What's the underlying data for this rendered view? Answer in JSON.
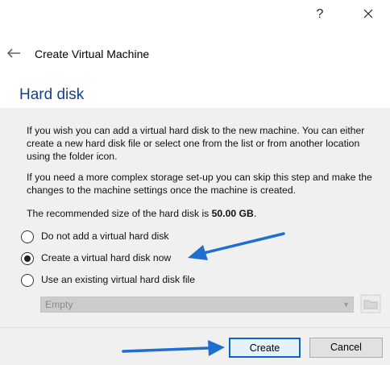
{
  "titlebar": {
    "help_label": "?"
  },
  "header": {
    "back_icon": "back-arrow-icon",
    "title": "Create Virtual Machine"
  },
  "page": {
    "title": "Hard disk",
    "para1": "If you wish you can add a virtual hard disk to the new machine. You can either create a new hard disk file or select one from the list or from another location using the folder icon.",
    "para2": "If you need a more complex storage set-up you can skip this step and make the changes to the machine settings once the machine is created.",
    "para3_prefix": "The recommended size of the hard disk is ",
    "para3_size": "50.00 GB",
    "para3_suffix": "."
  },
  "options": [
    {
      "label": "Do not add a virtual hard disk",
      "selected": false
    },
    {
      "label": "Create a virtual hard disk now",
      "selected": true
    },
    {
      "label": "Use an existing virtual hard disk file",
      "selected": false
    }
  ],
  "disk_select": {
    "value": "Empty",
    "enabled": false
  },
  "buttons": {
    "create": "Create",
    "cancel": "Cancel"
  },
  "colors": {
    "accent": "#0a64c8",
    "title_blue": "#1a3f8a",
    "annotation_arrow": "#1f6fd1"
  }
}
